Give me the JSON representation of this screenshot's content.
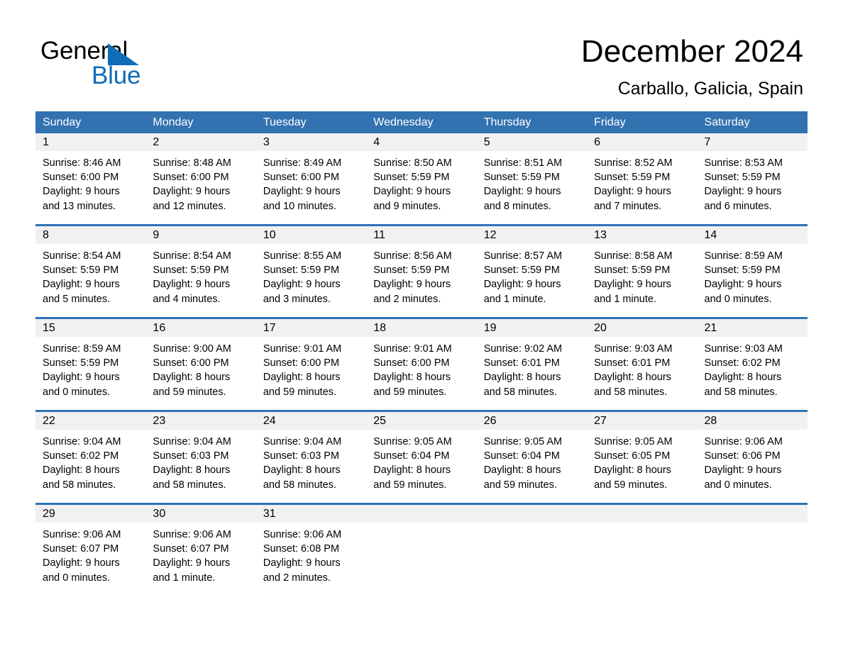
{
  "brand": {
    "name_part1": "General",
    "name_part2": "Blue",
    "triangle_color": "#0f6cb6"
  },
  "header": {
    "title": "December 2024",
    "location": "Carballo, Galicia, Spain"
  },
  "theme": {
    "header_blue": "#3272b0",
    "row_border_blue": "#2e74b5",
    "day_band_gray": "#f1f1f1",
    "text_black": "#000000",
    "header_text": "#ffffff"
  },
  "weekdays": [
    "Sunday",
    "Monday",
    "Tuesday",
    "Wednesday",
    "Thursday",
    "Friday",
    "Saturday"
  ],
  "weeks": [
    {
      "days": [
        {
          "number": "1",
          "sunrise": "Sunrise: 8:46 AM",
          "sunset": "Sunset: 6:00 PM",
          "daylight1": "Daylight: 9 hours",
          "daylight2": "and 13 minutes."
        },
        {
          "number": "2",
          "sunrise": "Sunrise: 8:48 AM",
          "sunset": "Sunset: 6:00 PM",
          "daylight1": "Daylight: 9 hours",
          "daylight2": "and 12 minutes."
        },
        {
          "number": "3",
          "sunrise": "Sunrise: 8:49 AM",
          "sunset": "Sunset: 6:00 PM",
          "daylight1": "Daylight: 9 hours",
          "daylight2": "and 10 minutes."
        },
        {
          "number": "4",
          "sunrise": "Sunrise: 8:50 AM",
          "sunset": "Sunset: 5:59 PM",
          "daylight1": "Daylight: 9 hours",
          "daylight2": "and 9 minutes."
        },
        {
          "number": "5",
          "sunrise": "Sunrise: 8:51 AM",
          "sunset": "Sunset: 5:59 PM",
          "daylight1": "Daylight: 9 hours",
          "daylight2": "and 8 minutes."
        },
        {
          "number": "6",
          "sunrise": "Sunrise: 8:52 AM",
          "sunset": "Sunset: 5:59 PM",
          "daylight1": "Daylight: 9 hours",
          "daylight2": "and 7 minutes."
        },
        {
          "number": "7",
          "sunrise": "Sunrise: 8:53 AM",
          "sunset": "Sunset: 5:59 PM",
          "daylight1": "Daylight: 9 hours",
          "daylight2": "and 6 minutes."
        }
      ]
    },
    {
      "days": [
        {
          "number": "8",
          "sunrise": "Sunrise: 8:54 AM",
          "sunset": "Sunset: 5:59 PM",
          "daylight1": "Daylight: 9 hours",
          "daylight2": "and 5 minutes."
        },
        {
          "number": "9",
          "sunrise": "Sunrise: 8:54 AM",
          "sunset": "Sunset: 5:59 PM",
          "daylight1": "Daylight: 9 hours",
          "daylight2": "and 4 minutes."
        },
        {
          "number": "10",
          "sunrise": "Sunrise: 8:55 AM",
          "sunset": "Sunset: 5:59 PM",
          "daylight1": "Daylight: 9 hours",
          "daylight2": "and 3 minutes."
        },
        {
          "number": "11",
          "sunrise": "Sunrise: 8:56 AM",
          "sunset": "Sunset: 5:59 PM",
          "daylight1": "Daylight: 9 hours",
          "daylight2": "and 2 minutes."
        },
        {
          "number": "12",
          "sunrise": "Sunrise: 8:57 AM",
          "sunset": "Sunset: 5:59 PM",
          "daylight1": "Daylight: 9 hours",
          "daylight2": "and 1 minute."
        },
        {
          "number": "13",
          "sunrise": "Sunrise: 8:58 AM",
          "sunset": "Sunset: 5:59 PM",
          "daylight1": "Daylight: 9 hours",
          "daylight2": "and 1 minute."
        },
        {
          "number": "14",
          "sunrise": "Sunrise: 8:59 AM",
          "sunset": "Sunset: 5:59 PM",
          "daylight1": "Daylight: 9 hours",
          "daylight2": "and 0 minutes."
        }
      ]
    },
    {
      "days": [
        {
          "number": "15",
          "sunrise": "Sunrise: 8:59 AM",
          "sunset": "Sunset: 5:59 PM",
          "daylight1": "Daylight: 9 hours",
          "daylight2": "and 0 minutes."
        },
        {
          "number": "16",
          "sunrise": "Sunrise: 9:00 AM",
          "sunset": "Sunset: 6:00 PM",
          "daylight1": "Daylight: 8 hours",
          "daylight2": "and 59 minutes."
        },
        {
          "number": "17",
          "sunrise": "Sunrise: 9:01 AM",
          "sunset": "Sunset: 6:00 PM",
          "daylight1": "Daylight: 8 hours",
          "daylight2": "and 59 minutes."
        },
        {
          "number": "18",
          "sunrise": "Sunrise: 9:01 AM",
          "sunset": "Sunset: 6:00 PM",
          "daylight1": "Daylight: 8 hours",
          "daylight2": "and 59 minutes."
        },
        {
          "number": "19",
          "sunrise": "Sunrise: 9:02 AM",
          "sunset": "Sunset: 6:01 PM",
          "daylight1": "Daylight: 8 hours",
          "daylight2": "and 58 minutes."
        },
        {
          "number": "20",
          "sunrise": "Sunrise: 9:03 AM",
          "sunset": "Sunset: 6:01 PM",
          "daylight1": "Daylight: 8 hours",
          "daylight2": "and 58 minutes."
        },
        {
          "number": "21",
          "sunrise": "Sunrise: 9:03 AM",
          "sunset": "Sunset: 6:02 PM",
          "daylight1": "Daylight: 8 hours",
          "daylight2": "and 58 minutes."
        }
      ]
    },
    {
      "days": [
        {
          "number": "22",
          "sunrise": "Sunrise: 9:04 AM",
          "sunset": "Sunset: 6:02 PM",
          "daylight1": "Daylight: 8 hours",
          "daylight2": "and 58 minutes."
        },
        {
          "number": "23",
          "sunrise": "Sunrise: 9:04 AM",
          "sunset": "Sunset: 6:03 PM",
          "daylight1": "Daylight: 8 hours",
          "daylight2": "and 58 minutes."
        },
        {
          "number": "24",
          "sunrise": "Sunrise: 9:04 AM",
          "sunset": "Sunset: 6:03 PM",
          "daylight1": "Daylight: 8 hours",
          "daylight2": "and 58 minutes."
        },
        {
          "number": "25",
          "sunrise": "Sunrise: 9:05 AM",
          "sunset": "Sunset: 6:04 PM",
          "daylight1": "Daylight: 8 hours",
          "daylight2": "and 59 minutes."
        },
        {
          "number": "26",
          "sunrise": "Sunrise: 9:05 AM",
          "sunset": "Sunset: 6:04 PM",
          "daylight1": "Daylight: 8 hours",
          "daylight2": "and 59 minutes."
        },
        {
          "number": "27",
          "sunrise": "Sunrise: 9:05 AM",
          "sunset": "Sunset: 6:05 PM",
          "daylight1": "Daylight: 8 hours",
          "daylight2": "and 59 minutes."
        },
        {
          "number": "28",
          "sunrise": "Sunrise: 9:06 AM",
          "sunset": "Sunset: 6:06 PM",
          "daylight1": "Daylight: 9 hours",
          "daylight2": "and 0 minutes."
        }
      ]
    },
    {
      "days": [
        {
          "number": "29",
          "sunrise": "Sunrise: 9:06 AM",
          "sunset": "Sunset: 6:07 PM",
          "daylight1": "Daylight: 9 hours",
          "daylight2": "and 0 minutes."
        },
        {
          "number": "30",
          "sunrise": "Sunrise: 9:06 AM",
          "sunset": "Sunset: 6:07 PM",
          "daylight1": "Daylight: 9 hours",
          "daylight2": "and 1 minute."
        },
        {
          "number": "31",
          "sunrise": "Sunrise: 9:06 AM",
          "sunset": "Sunset: 6:08 PM",
          "daylight1": "Daylight: 9 hours",
          "daylight2": "and 2 minutes."
        },
        {
          "number": "",
          "sunrise": "",
          "sunset": "",
          "daylight1": "",
          "daylight2": ""
        },
        {
          "number": "",
          "sunrise": "",
          "sunset": "",
          "daylight1": "",
          "daylight2": ""
        },
        {
          "number": "",
          "sunrise": "",
          "sunset": "",
          "daylight1": "",
          "daylight2": ""
        },
        {
          "number": "",
          "sunrise": "",
          "sunset": "",
          "daylight1": "",
          "daylight2": ""
        }
      ]
    }
  ]
}
